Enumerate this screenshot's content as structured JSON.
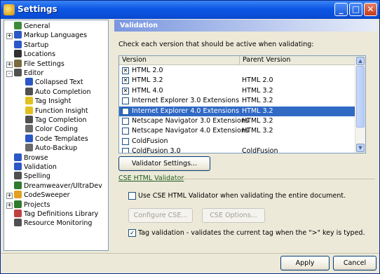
{
  "window": {
    "title": "Settings"
  },
  "tree": {
    "items": [
      {
        "label": "General",
        "color": "#3d8a3d",
        "indent": 0,
        "expander": ""
      },
      {
        "label": "Markup Languages",
        "color": "#2b58c6",
        "indent": 0,
        "expander": "+"
      },
      {
        "label": "Startup",
        "color": "#2b58c6",
        "indent": 0,
        "expander": ""
      },
      {
        "label": "Locations",
        "color": "#303030",
        "indent": 0,
        "expander": ""
      },
      {
        "label": "File Settings",
        "color": "#7a6b3d",
        "indent": 0,
        "expander": "+"
      },
      {
        "label": "Editor",
        "color": "#505050",
        "indent": 0,
        "expander": "-"
      },
      {
        "label": "Collapsed Text",
        "color": "#2b58c6",
        "indent": 1,
        "expander": ""
      },
      {
        "label": "Auto Completion",
        "color": "#505050",
        "indent": 1,
        "expander": ""
      },
      {
        "label": "Tag Insight",
        "color": "#e2c020",
        "indent": 1,
        "expander": ""
      },
      {
        "label": "Function Insight",
        "color": "#e2c020",
        "indent": 1,
        "expander": ""
      },
      {
        "label": "Tag Completion",
        "color": "#505050",
        "indent": 1,
        "expander": ""
      },
      {
        "label": "Color Coding",
        "color": "#6a6a6a",
        "indent": 1,
        "expander": ""
      },
      {
        "label": "Code Templates",
        "color": "#2b58c6",
        "indent": 1,
        "expander": ""
      },
      {
        "label": "Auto-Backup",
        "color": "#6a6a6a",
        "indent": 1,
        "expander": ""
      },
      {
        "label": "Browse",
        "color": "#2b58c6",
        "indent": 0,
        "expander": ""
      },
      {
        "label": "Validation",
        "color": "#2b58c6",
        "indent": 0,
        "expander": ""
      },
      {
        "label": "Spelling",
        "color": "#505050",
        "indent": 0,
        "expander": ""
      },
      {
        "label": "Dreamweaver/UltraDev",
        "color": "#2e7a2e",
        "indent": 0,
        "expander": ""
      },
      {
        "label": "CodeSweeper",
        "color": "#e2a020",
        "indent": 0,
        "expander": "+"
      },
      {
        "label": "Projects",
        "color": "#2e7a2e",
        "indent": 0,
        "expander": "+"
      },
      {
        "label": "Tag Definitions Library",
        "color": "#c04040",
        "indent": 0,
        "expander": ""
      },
      {
        "label": "Resource Monitoring",
        "color": "#505050",
        "indent": 0,
        "expander": ""
      }
    ]
  },
  "panel": {
    "header": "Validation",
    "instruction": "Check each version that should be active when validating:",
    "columns": {
      "version": "Version",
      "parent": "Parent Version"
    },
    "rows": [
      {
        "name": "HTML 2.0",
        "parent": "",
        "checked": true,
        "selected": false
      },
      {
        "name": "HTML 3.2",
        "parent": "HTML 2.0",
        "checked": true,
        "selected": false
      },
      {
        "name": "HTML 4.0",
        "parent": "HTML 3.2",
        "checked": true,
        "selected": false
      },
      {
        "name": "Internet Explorer 3.0 Extensions",
        "parent": "HTML 3.2",
        "checked": false,
        "selected": false
      },
      {
        "name": "Internet Explorer 4.0 Extensions",
        "parent": "HTML 3.2",
        "checked": false,
        "selected": true
      },
      {
        "name": "Netscape Navigator 3.0 Extensions",
        "parent": "HTML 3.2",
        "checked": false,
        "selected": false
      },
      {
        "name": "Netscape Navigator 4.0 Extensions",
        "parent": "HTML 3.2",
        "checked": false,
        "selected": false
      },
      {
        "name": "ColdFusion",
        "parent": "",
        "checked": false,
        "selected": false
      },
      {
        "name": "ColdFusion 3.0",
        "parent": "ColdFusion",
        "checked": false,
        "selected": false
      }
    ],
    "validator_settings_button": "Validator Settings...",
    "cse_section_title": "CSE HTML Validator",
    "use_cse_label": "Use CSE HTML Validator when validating the entire document.",
    "use_cse_checked": false,
    "configure_cse_button": "Configure CSE...",
    "cse_options_button": "CSE Options...",
    "tag_validation_label": "Tag validation - validates the current tag when the \">\" key is typed.",
    "tag_validation_checked": true
  },
  "footer": {
    "apply": "Apply",
    "cancel": "Cancel"
  }
}
